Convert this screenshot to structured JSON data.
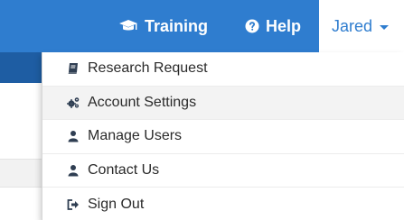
{
  "navbar": {
    "training_label": "Training",
    "help_label": "Help",
    "user_label": "Jared"
  },
  "dropdown": {
    "items": [
      {
        "label": "Research Request",
        "icon": "book-icon"
      },
      {
        "label": "Account Settings",
        "icon": "gears-icon"
      },
      {
        "label": "Manage Users",
        "icon": "user-icon"
      },
      {
        "label": "Contact Us",
        "icon": "user-icon"
      },
      {
        "label": "Sign Out",
        "icon": "sign-out-icon"
      }
    ]
  },
  "colors": {
    "nav_blue": "#2f7dcf",
    "sub_blue": "#1e5da3",
    "icon_dark": "#2f3e52"
  }
}
